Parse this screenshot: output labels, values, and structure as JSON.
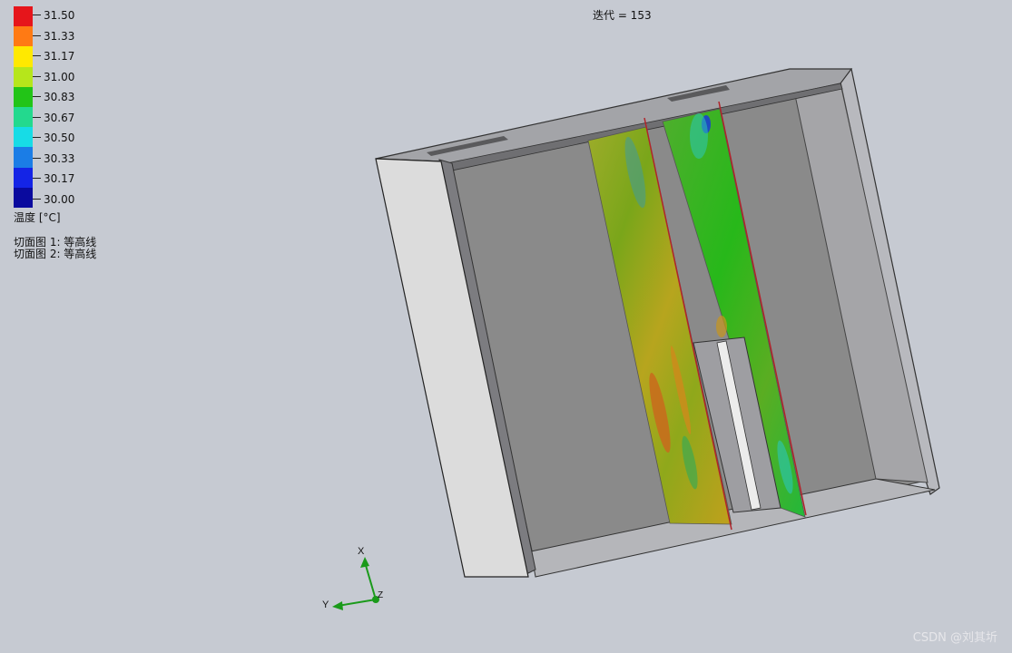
{
  "legend": {
    "ticks": [
      "31.50",
      "31.33",
      "31.17",
      "31.00",
      "30.83",
      "30.67",
      "30.50",
      "30.33",
      "30.17",
      "30.00"
    ],
    "unit_label": "温度 [°C]",
    "colors": [
      "#e6151b",
      "#ff7a14",
      "#ffe900",
      "#b6e61b",
      "#22c417",
      "#23d98e",
      "#17dce6",
      "#1b7de6",
      "#1424e6",
      "#0a0a9e"
    ]
  },
  "cut_plots": [
    "切面图 1: 等高线",
    "切面图 2: 等高线"
  ],
  "iteration_label": "迭代 = 153",
  "triad": {
    "x": "X",
    "y": "Y",
    "z": "Z"
  },
  "watermark": "CSDN @刘其圻"
}
